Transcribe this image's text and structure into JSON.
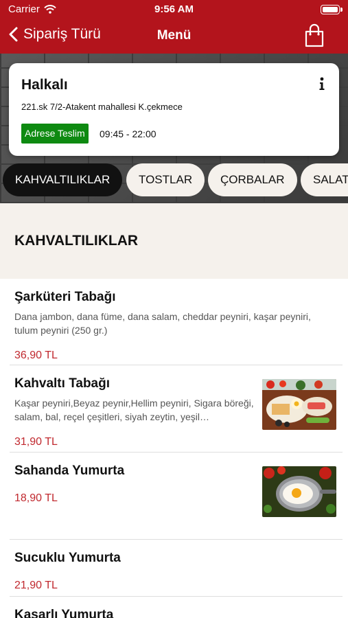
{
  "status_bar": {
    "carrier": "Carrier",
    "time": "9:56 AM"
  },
  "nav": {
    "back_label": "Sipariş Türü",
    "title": "Menü"
  },
  "restaurant": {
    "name": "Halkalı",
    "address": "221.sk 7/2-Atakent mahallesi K.çekmece",
    "delivery_badge": "Adrese Teslim",
    "hours": "09:45 - 22:00"
  },
  "categories": [
    {
      "label": "KAHVALTILIKLAR"
    },
    {
      "label": "TOSTLAR"
    },
    {
      "label": "ÇORBALAR"
    },
    {
      "label": "SALATALAR"
    }
  ],
  "section_title": "KAHVALTILIKLAR",
  "items": [
    {
      "name": "Şarküteri Tabağı",
      "description": "Dana jambon, dana füme, dana salam, cheddar peyniri, kaşar peyniri, tulum peyniri (250 gr.)",
      "price": "36,90 TL"
    },
    {
      "name": "Kahvaltı Tabağı",
      "description": "Kaşar peyniri,Beyaz peynir,Hellim peyniri, Sigara böreği, salam, bal, reçel çeşitleri, siyah zeytin, yeşil…",
      "price": "31,90 TL"
    },
    {
      "name": "Sahanda Yumurta",
      "price": "18,90 TL"
    },
    {
      "name": "Sucuklu Yumurta",
      "price": "21,90 TL"
    },
    {
      "name": "Kaşarlı Yumurta"
    }
  ],
  "colors": {
    "brand": "#b3141c",
    "badge": "#0e8a11",
    "price": "#c0282e",
    "section_bg": "#f5f1ec"
  }
}
